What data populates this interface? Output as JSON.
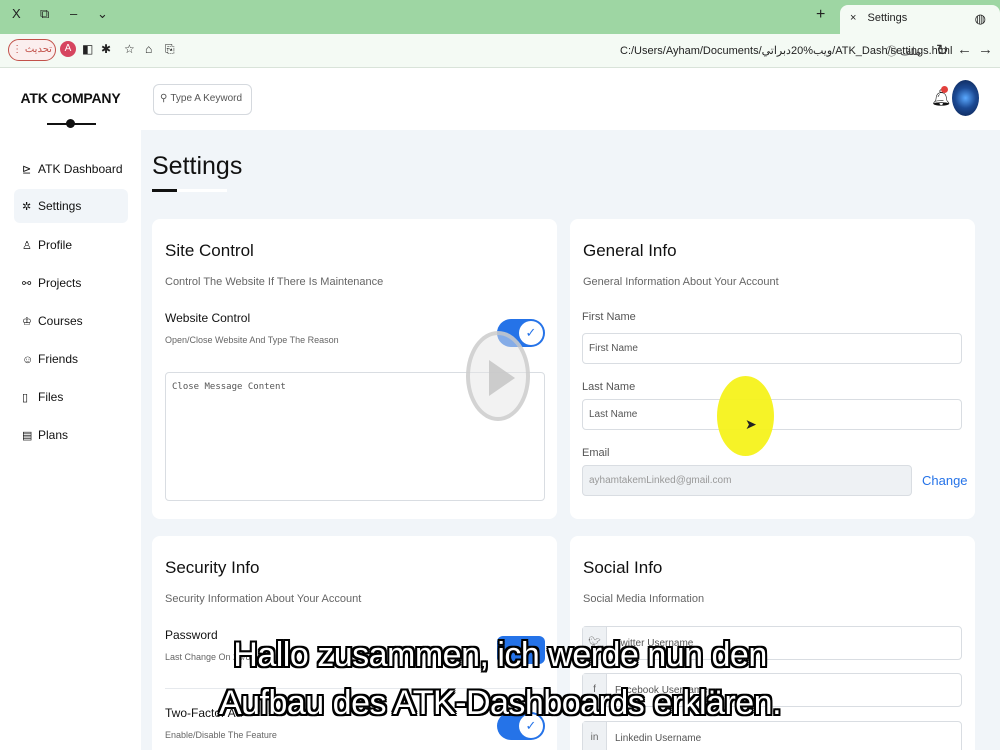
{
  "browser": {
    "window_controls": [
      "X",
      "⧉",
      "–",
      "⌄"
    ],
    "new_tab": "+",
    "tab_close": "×",
    "tab_title": "Settings",
    "update_label": "تحديث",
    "profile_letter": "A",
    "url": "C:/Users/Ayham/Documents/ويب%20دبراتي/ATK_Dash/settings.html",
    "url_prefix": "ملف"
  },
  "sidebar": {
    "brand": "ATK COMPANY",
    "items": [
      {
        "label": "ATK Dashboard",
        "icon": "chart-icon"
      },
      {
        "label": "Settings",
        "icon": "gear-icon"
      },
      {
        "label": "Profile",
        "icon": "user-icon"
      },
      {
        "label": "Projects",
        "icon": "diagram-icon"
      },
      {
        "label": "Courses",
        "icon": "graduation-icon"
      },
      {
        "label": "Friends",
        "icon": "friends-icon"
      },
      {
        "label": "Files",
        "icon": "file-icon"
      },
      {
        "label": "Plans",
        "icon": "plans-icon"
      }
    ]
  },
  "header": {
    "search_placeholder": "Type A Keyword"
  },
  "page": {
    "title": "Settings"
  },
  "site_control": {
    "title": "Site Control",
    "desc": "Control The Website If There Is Maintenance",
    "label": "Website Control",
    "sub": "Open/Close Website And Type The Reason",
    "textarea_placeholder": "Close Message Content",
    "toggle_on": true
  },
  "general_info": {
    "title": "General Info",
    "desc": "General Information About Your Account",
    "first_name_label": "First Name",
    "first_name_placeholder": "First Name",
    "last_name_label": "Last Name",
    "last_name_placeholder": "Last Name",
    "email_label": "Email",
    "email_value": "ayhamtakemLinked@gmail.com",
    "change_label": "Change"
  },
  "security_info": {
    "title": "Security Info",
    "desc": "Security Information About Your Account",
    "password_label": "Password",
    "password_sub": "Last Change On 25/8/",
    "twofa_label": "Two-Factor Au",
    "twofa_sub": "Enable/Disable The Feature"
  },
  "social_info": {
    "title": "Social Info",
    "desc": "Social Media Information",
    "fields": [
      {
        "icon": "twitter-icon",
        "placeholder": "Twitter Username"
      },
      {
        "icon": "facebook-icon",
        "placeholder": "Facebook Username"
      },
      {
        "icon": "linkedin-icon",
        "placeholder": "Linkedin Username"
      }
    ]
  },
  "subtitles": {
    "line1": "Hallo zusammen, ich werde nun den",
    "line2": "Aufbau des ATK-Dashboards erklären."
  },
  "colors": {
    "accent": "#2573e8",
    "tabbar": "#9ed6a3",
    "page_bg": "#f1f5f9"
  }
}
